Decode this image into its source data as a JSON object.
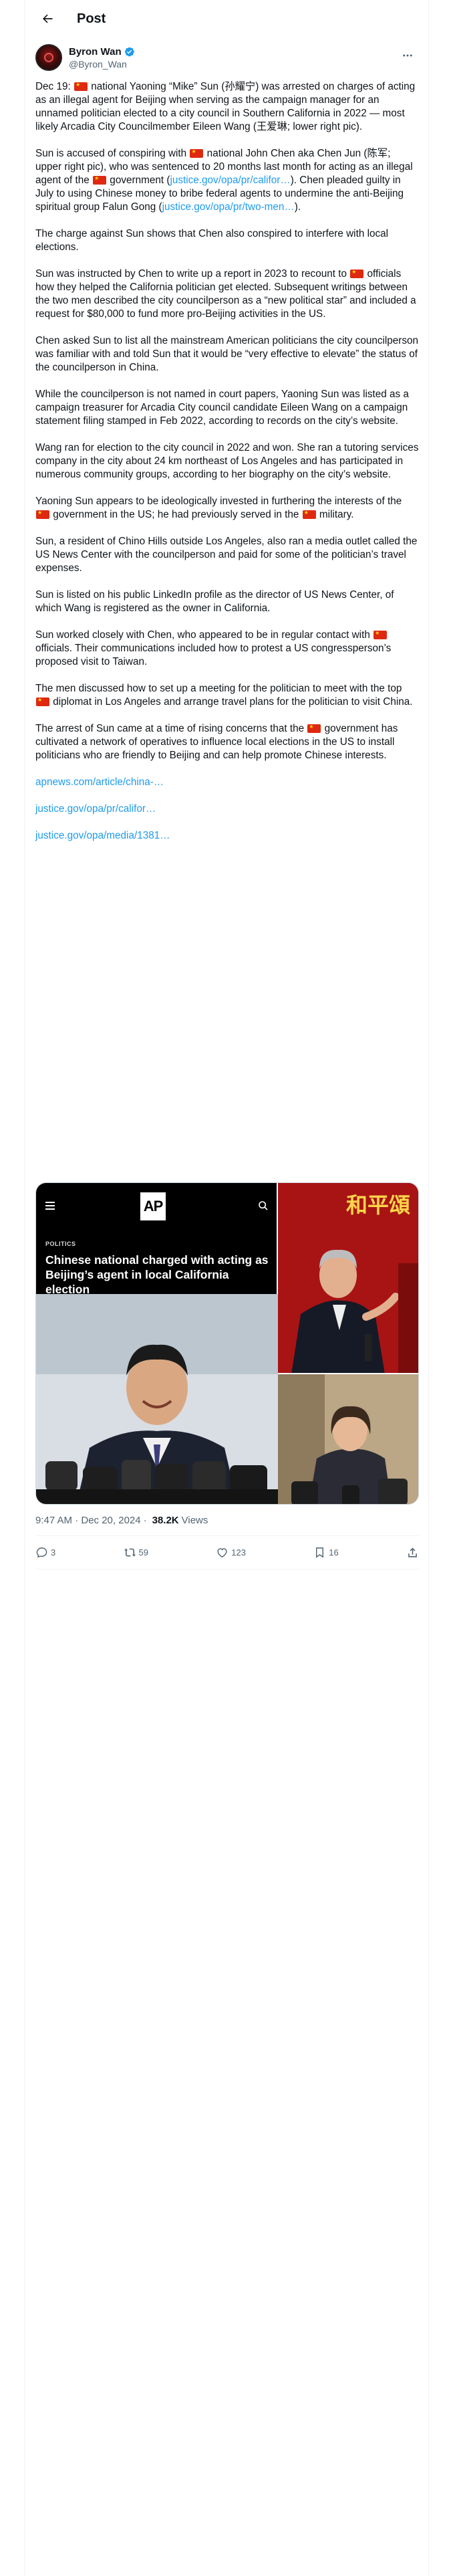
{
  "header": {
    "title": "Post"
  },
  "author": {
    "display_name": "Byron Wan",
    "handle": "@Byron_Wan"
  },
  "tweet": {
    "p1a": "Dec 19: ",
    "p1b": " national Yaoning “Mike” Sun (孙耀宁) was arrested on charges of acting as an illegal agent for Beijing when serving as the campaign manager for an unnamed politician elected to a city council in Southern California in 2022 — most likely Arcadia City Councilmember Eileen Wang (王爱琳; lower right pic).",
    "p2a": "Sun is accused of conspiring with ",
    "p2b": " national John Chen aka Chen Jun (陈军; upper right pic), who was sentenced to 20 months last month for acting as an illegal agent of the ",
    "p2c": " government (",
    "p2link1": "justice.gov/opa/pr/califor…",
    "p2d": "). Chen pleaded guilty in July to using Chinese money to bribe federal agents to undermine the anti-Beijing spiritual group Falun Gong (",
    "p2link2": "justice.gov/opa/pr/two-men…",
    "p2e": ").",
    "p3": "The charge against Sun shows that Chen also conspired to interfere with local elections.",
    "p4a": "Sun was instructed by Chen to write up a report in 2023 to recount to ",
    "p4b": " officials how they helped the California politician get elected. Subsequent writings between the two men described the city councilperson as a “new political star” and included a request for $80,000 to fund more pro-Beijing activities in the US.",
    "p5": "Chen asked Sun to list all the mainstream American politicians the city councilperson was familiar with and told Sun that it would be “very effective to elevate” the status of the councilperson in China.",
    "p6": "While the councilperson is not named in court papers, Yaoning Sun was listed as a campaign treasurer for Arcadia City council candidate Eileen Wang on a campaign statement filing stamped in Feb 2022, according to records on the city’s website.",
    "p7": "Wang ran for election to the city council in 2022 and won. She ran a tutoring services company in the city about 24 km northeast of Los Angeles and has participated in numerous community groups, according to her biography on the city’s website.",
    "p8a": "Yaoning Sun appears to be ideologically invested in furthering the interests of the ",
    "p8b": " government in the US; he had previously served in the ",
    "p8c": " military.",
    "p9": "Sun, a resident of Chino Hills outside Los Angeles, also ran a media outlet called the US News Center with the councilperson and paid for some of the politician’s travel expenses.",
    "p10": "Sun is listed on his public LinkedIn profile as the director of US News Center, of which Wang is registered as the owner in California.",
    "p11a": "Sun worked closely with Chen, who appeared to be in regular contact with ",
    "p11b": " officials. Their communications included how to protest a US congressperson’s proposed visit to Taiwan.",
    "p12a": "The men discussed how to set up a meeting for the politician to meet with the top ",
    "p12b": " diplomat in Los Angeles and arrange travel plans for the politician to visit China.",
    "p13a": "The arrest of Sun came at a time of rising concerns that the ",
    "p13b": " government has cultivated a network of operatives to influence local elections in the US to install politicians who are friendly to Beijing and can help promote Chinese interests.",
    "link_a": "apnews.com/article/china-…",
    "link_b": "justice.gov/opa/pr/califor…",
    "link_c": "justice.gov/opa/media/1381…"
  },
  "media": {
    "ap_logo": "AP",
    "section": "POLITICS",
    "headline": "Chinese national charged with acting as Beijing’s agent in local California election",
    "banner_chars": "和平頌"
  },
  "meta": {
    "time": "9:47 AM · Dec 20, 2024",
    "views_count": "38.2K",
    "views_label": "Views"
  },
  "actions": {
    "replies": "3",
    "reposts": "59",
    "likes": "123",
    "bookmarks": "16"
  },
  "colors": {
    "link": "#1d9bf0",
    "text": "#0f1419",
    "secondary": "#536471",
    "verified": "#1d9bf0",
    "flag": "#de2910"
  }
}
